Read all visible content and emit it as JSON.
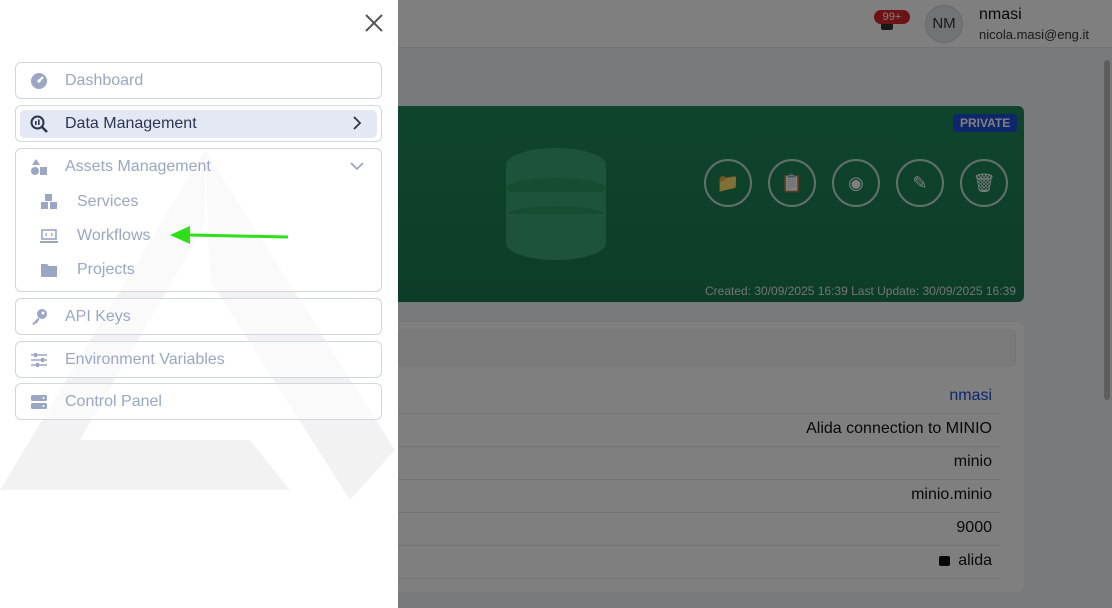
{
  "header": {
    "notification_count": "99+",
    "avatar_initials": "NM",
    "user_name": "nmasi",
    "user_email": "nicola.masi@eng.it"
  },
  "resource_card": {
    "visibility": "PRIVATE",
    "dates": "Created: 30/09/2025 16:39  Last Update: 30/09/2025 16:39",
    "actions": [
      "folder-gear-icon",
      "clipboard-icon",
      "eye-icon",
      "pencil-icon",
      "trash-icon"
    ],
    "color": "#1f8a5a"
  },
  "details": {
    "owner": "nmasi",
    "name": "Alida connection to MINIO",
    "type": "minio",
    "host": "minio.minio",
    "port": "9000",
    "bucket": "alida"
  },
  "sidebar": {
    "items": [
      {
        "label": "Dashboard",
        "icon": "gauge-icon"
      },
      {
        "label": "Data Management",
        "icon": "magnifier-chart-icon",
        "active": true
      },
      {
        "label": "Assets Management",
        "icon": "shapes-icon",
        "expanded": true,
        "children": [
          {
            "label": "Services",
            "icon": "cubes-icon"
          },
          {
            "label": "Workflows",
            "icon": "laptop-code-icon"
          },
          {
            "label": "Projects",
            "icon": "folder-icon"
          }
        ]
      },
      {
        "label": "API Keys",
        "icon": "key-icon"
      },
      {
        "label": "Environment Variables",
        "icon": "sliders-icon"
      },
      {
        "label": "Control Panel",
        "icon": "server-icon"
      }
    ]
  },
  "colors": {
    "active_bg": "#e4e8f4",
    "menu_text": "#9aa6c4",
    "annotation_arrow": "#2ee01a"
  }
}
